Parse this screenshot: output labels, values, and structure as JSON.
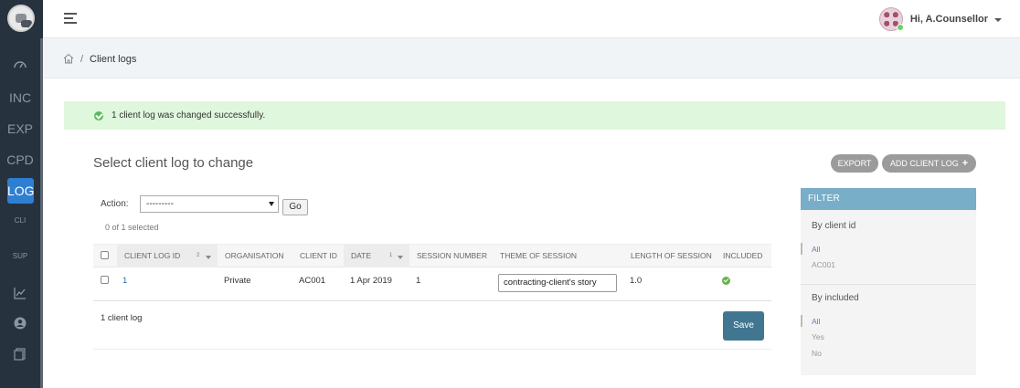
{
  "sidebar": {
    "items": [
      {
        "label": "INC"
      },
      {
        "label": "EXP"
      },
      {
        "label": "CPD"
      },
      {
        "label": "LOG"
      },
      {
        "label": "CLI"
      },
      {
        "label": "SUP"
      }
    ],
    "icons": [
      "dashboard-icon",
      "chart-icon",
      "user-circle-icon",
      "documents-icon"
    ]
  },
  "header": {
    "user_greeting": "Hi, A.Counsellor"
  },
  "breadcrumb": {
    "separator": "/",
    "current": "Client logs"
  },
  "message": {
    "text": "1 client log was changed successfully."
  },
  "page": {
    "title": "Select client log to change"
  },
  "toolbar": {
    "export_label": "EXPORT",
    "add_label": "ADD CLIENT LOG",
    "add_icon": "+"
  },
  "actions": {
    "label": "Action:",
    "selected_value": "---------",
    "go_label": "Go",
    "selected_count": "0 of 1 selected"
  },
  "table": {
    "columns": [
      {
        "label": "CLIENT LOG ID",
        "sort_index": "2"
      },
      {
        "label": "ORGANISATION"
      },
      {
        "label": "CLIENT ID"
      },
      {
        "label": "DATE",
        "sort_index": "1"
      },
      {
        "label": "SESSION NUMBER"
      },
      {
        "label": "THEME OF SESSION"
      },
      {
        "label": "LENGTH OF SESSION"
      },
      {
        "label": "INCLUDED"
      }
    ],
    "rows": [
      {
        "client_log_id": "1",
        "organisation": "Private",
        "client_id": "AC001",
        "date": "1 Apr 2019",
        "session_number": "1",
        "theme": "contracting-client's story",
        "length": "1.0",
        "included": true
      }
    ],
    "count_text": "1 client log",
    "save_label": "Save"
  },
  "filter": {
    "title": "FILTER",
    "sections": [
      {
        "title": "By client id",
        "options": [
          "All",
          "AC001"
        ],
        "selected": "All"
      },
      {
        "title": "By included",
        "options": [
          "All",
          "Yes",
          "No"
        ],
        "selected": "All"
      }
    ]
  },
  "colors": {
    "sidebar_bg": "#27323f",
    "active_nav": "#2e7fd1",
    "success_bg": "#dff7dc",
    "filter_header": "#79aec8",
    "save_button": "#417690"
  }
}
